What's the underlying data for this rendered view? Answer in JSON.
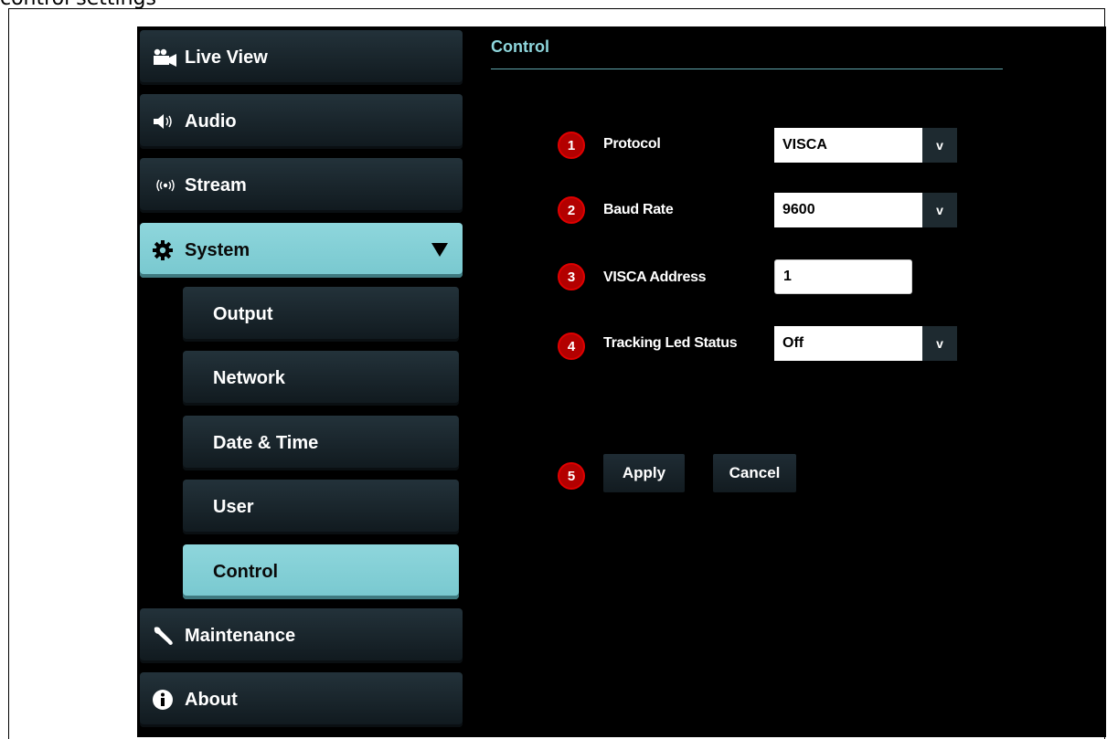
{
  "header_text": "control settings",
  "sidebar": {
    "items": [
      {
        "label": "Live View",
        "icon": "video-camera-icon"
      },
      {
        "label": "Audio",
        "icon": "speaker-icon"
      },
      {
        "label": "Stream",
        "icon": "broadcast-icon"
      },
      {
        "label": "System",
        "icon": "gear-icon",
        "expanded": true
      },
      {
        "label": "Maintenance",
        "icon": "wrench-icon"
      },
      {
        "label": "About",
        "icon": "info-icon"
      }
    ],
    "system_subitems": [
      {
        "label": "Output"
      },
      {
        "label": "Network"
      },
      {
        "label": "Date & Time"
      },
      {
        "label": "User"
      },
      {
        "label": "Control",
        "active": true
      }
    ]
  },
  "main": {
    "title": "Control",
    "fields": {
      "protocol": {
        "number": "1",
        "label": "Protocol",
        "value": "VISCA"
      },
      "baud_rate": {
        "number": "2",
        "label": "Baud Rate",
        "value": "9600"
      },
      "visca_address": {
        "number": "3",
        "label": "VISCA Address",
        "value": "1"
      },
      "tracking_led": {
        "number": "4",
        "label": "Tracking Led Status",
        "value": "Off"
      }
    },
    "actions": {
      "number": "5",
      "apply_label": "Apply",
      "cancel_label": "Cancel"
    },
    "dropdown_glyph": "v"
  },
  "colors": {
    "accent": "#8ed6dc",
    "background": "#000000",
    "nav_item": "#1a252b",
    "badge": "#e00000"
  }
}
